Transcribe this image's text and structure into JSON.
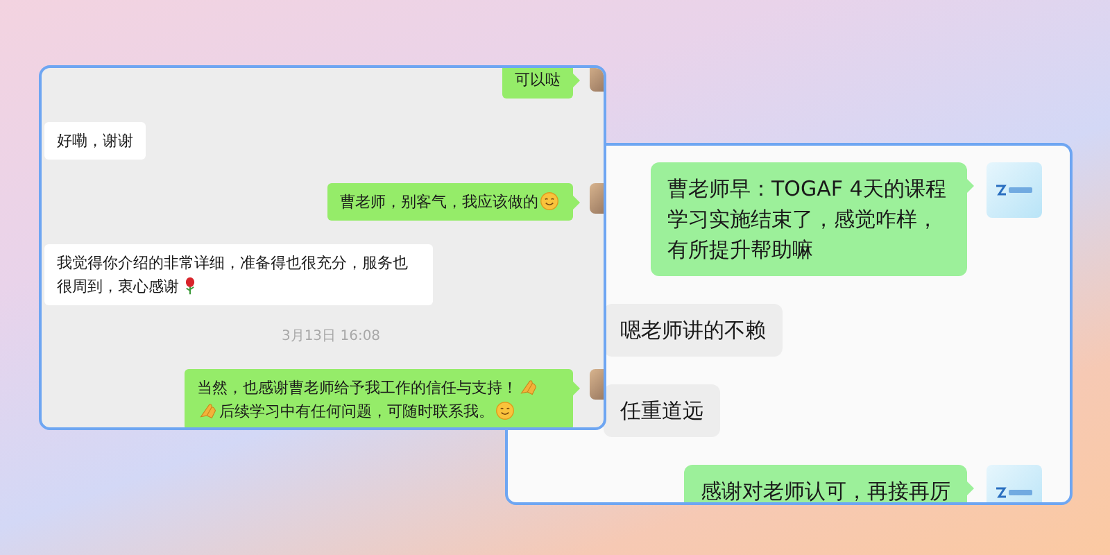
{
  "back_window": {
    "messages": [
      {
        "kind": "sent",
        "parts": [
          {
            "kind": "text",
            "text": "曹老师早：TOGAF  4天的课程学习实施结束了，感觉咋样，有所提升帮助嘛"
          }
        ]
      },
      {
        "kind": "received",
        "parts": [
          {
            "kind": "text",
            "text": "嗯老师讲的不赖"
          }
        ]
      },
      {
        "kind": "received",
        "parts": [
          {
            "kind": "text",
            "text": "任重道远"
          }
        ]
      },
      {
        "kind": "sent",
        "parts": [
          {
            "kind": "text",
            "text": "感谢对老师认可，再接再厉"
          }
        ]
      }
    ]
  },
  "front_window": {
    "messages": [
      {
        "kind": "sent",
        "parts": [
          {
            "kind": "text",
            "text": "可以哒"
          }
        ]
      },
      {
        "kind": "received",
        "parts": [
          {
            "kind": "text",
            "text": "好嘞，谢谢"
          }
        ]
      },
      {
        "kind": "sent",
        "parts": [
          {
            "kind": "text",
            "text": "曹老师，别客气，我应该做的"
          },
          {
            "kind": "smile"
          }
        ]
      },
      {
        "kind": "received",
        "parts": [
          {
            "kind": "text",
            "text": "我觉得你介绍的非常详细，准备得也很充分，服务也很周到，衷心感谢"
          },
          {
            "kind": "rose"
          }
        ]
      },
      {
        "kind": "time",
        "parts": [
          {
            "kind": "text",
            "text": "3月13日 16:08"
          }
        ]
      },
      {
        "kind": "sent",
        "parts": [
          {
            "kind": "text",
            "text": "当然，也感谢曹老师给予我工作的信任与支持！"
          },
          {
            "kind": "hands"
          },
          {
            "kind": "hands"
          },
          {
            "kind": "text",
            "text": "后续学习中有任何问题，可随时联系我。"
          },
          {
            "kind": "smile"
          }
        ]
      }
    ]
  }
}
